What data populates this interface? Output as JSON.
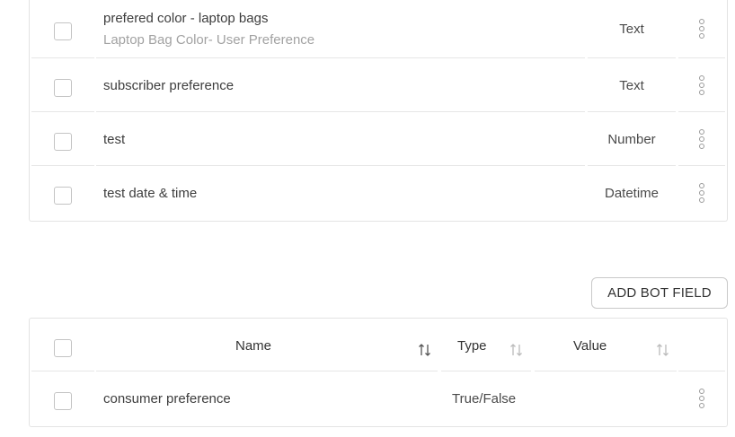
{
  "custom_fields": [
    {
      "name": "prefered color - laptop bags",
      "description": "Laptop Bag Color- User Preference",
      "type": "Text"
    },
    {
      "name": "subscriber preference",
      "description": "",
      "type": "Text"
    },
    {
      "name": "test",
      "description": "",
      "type": "Number"
    },
    {
      "name": "test date & time",
      "description": "",
      "type": "Datetime"
    }
  ],
  "add_bot_field_label": "ADD BOT FIELD",
  "bot_table": {
    "headers": {
      "name": "Name",
      "type": "Type",
      "value": "Value"
    },
    "rows": [
      {
        "name": "consumer preference",
        "type": "True/False",
        "value": ""
      }
    ]
  },
  "icons": {
    "row_menu": "more-vertical-icon",
    "sort": "sort-arrows-icon"
  }
}
